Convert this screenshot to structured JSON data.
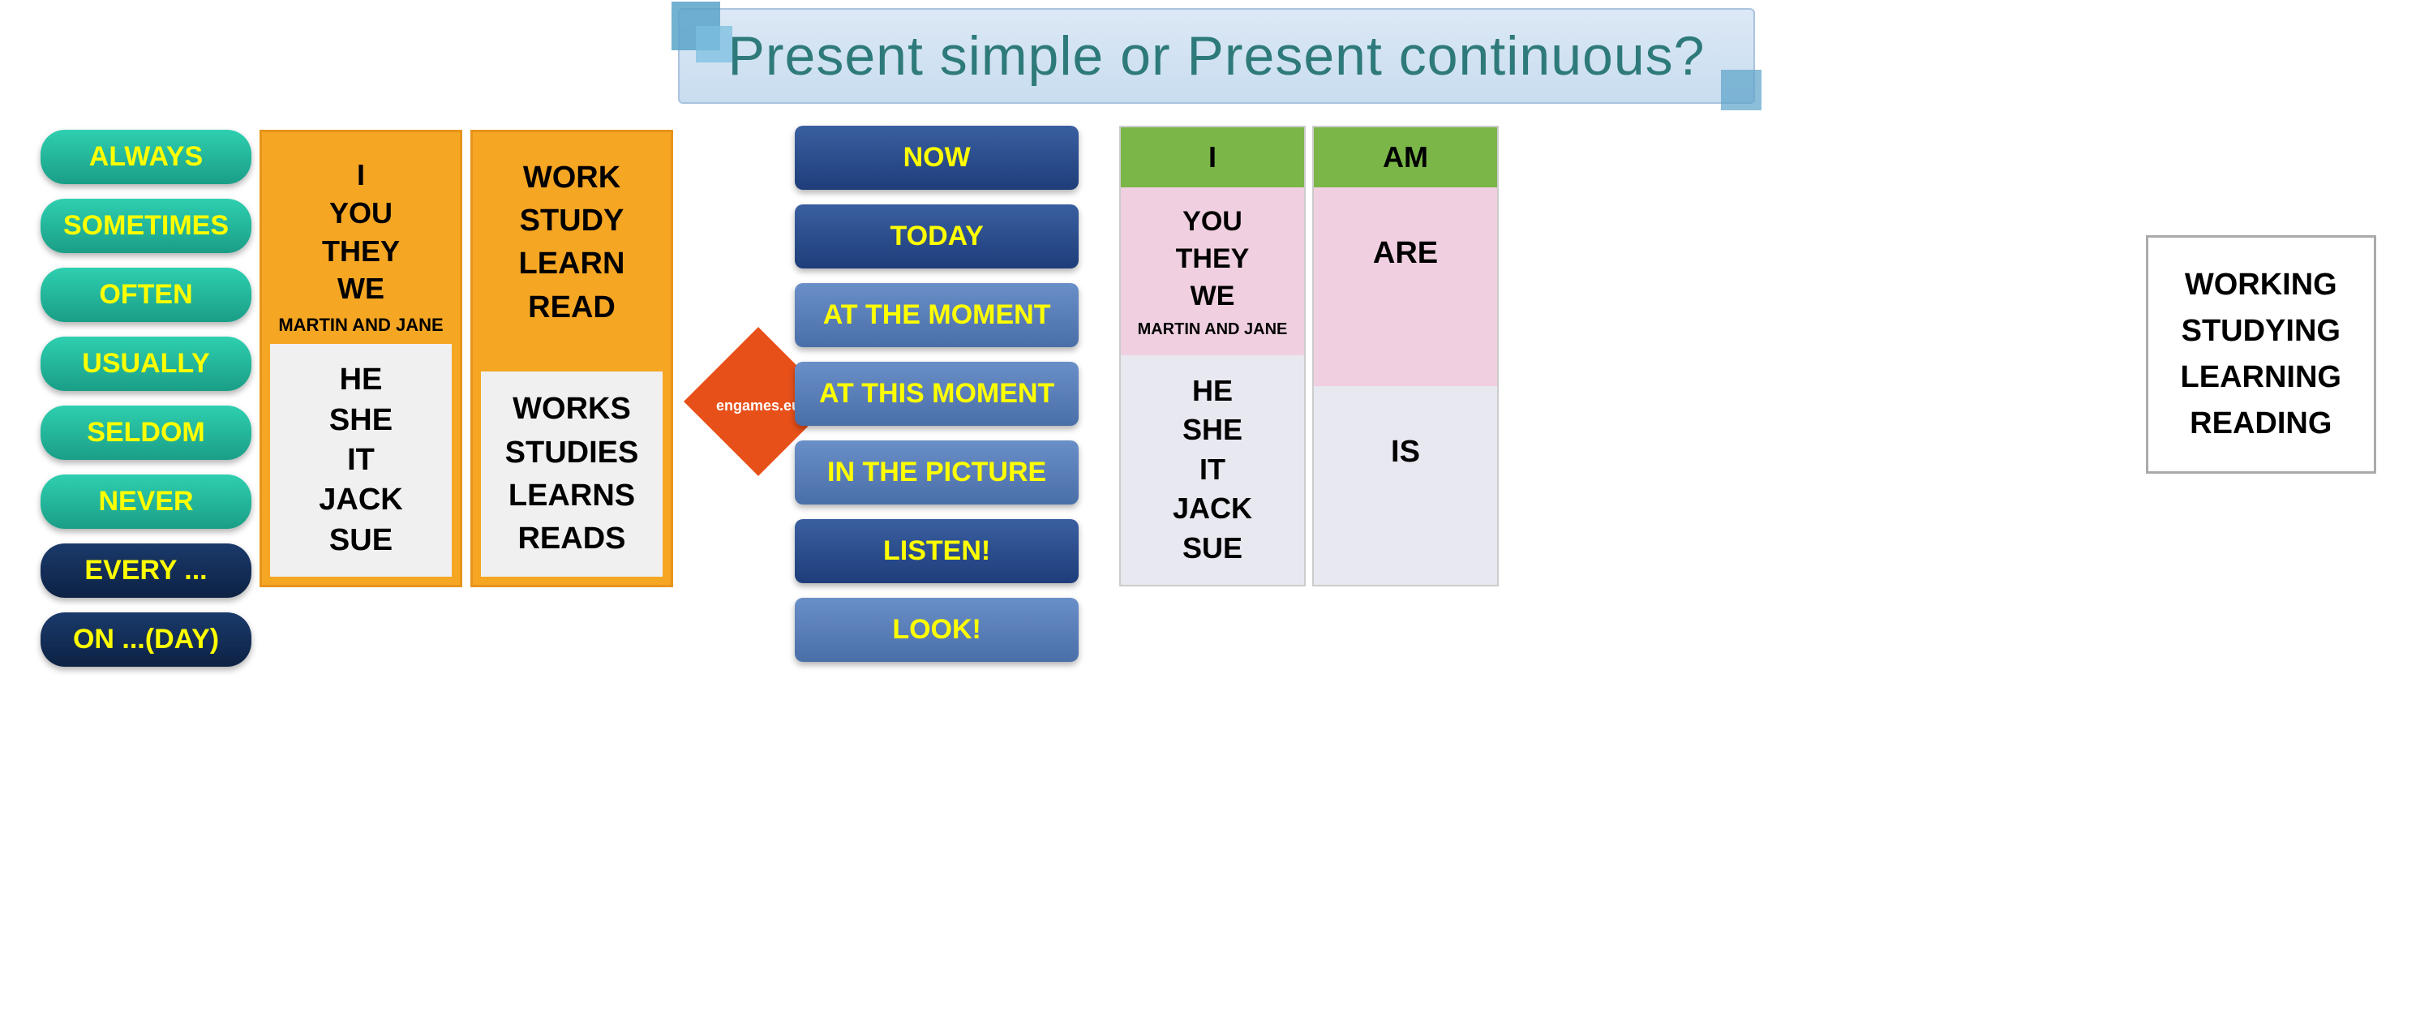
{
  "header": {
    "title": "Present simple or Present continuous?"
  },
  "sidebar": {
    "adverbs_teal": [
      "ALWAYS",
      "SOMETIMES",
      "OFTEN",
      "USUALLY",
      "SELDOM",
      "NEVER"
    ],
    "adverbs_dark": [
      "EVERY ...",
      "ON ...(DAY)"
    ]
  },
  "subjects": {
    "top_label": "I\nYOU\nTHEY\nWE",
    "top_sub": "MARTIN AND JANE",
    "bottom_label": "HE\nSHE\nIT\nJACK\nSUE"
  },
  "verbs_simple": {
    "top": "WORK\nSTUDY\nLEARN\nREAD",
    "bottom": "WORKS\nSTUDIES\nLEARNS\nREADS"
  },
  "diamond": {
    "label": "engames.eu"
  },
  "time_expressions": {
    "buttons": [
      "NOW",
      "TODAY",
      "AT THE MOMENT",
      "AT THIS MOMENT",
      "IN THE PICTURE",
      "LISTEN!",
      "LOOK!"
    ]
  },
  "conjugation": {
    "col1_header": "I",
    "col1_top_pronouns": "YOU\nTHEY\nWE",
    "col1_top_sub": "MARTIN AND JANE",
    "col1_bottom": "HE\nSHE\nIT\nJACK\nSUE",
    "col2_header": "AM",
    "col2_top_verb": "ARE",
    "col2_bottom_verb": "IS"
  },
  "ing_forms": {
    "text": "WORKING\nSTUDYING\nLEARNING\nREADING"
  }
}
